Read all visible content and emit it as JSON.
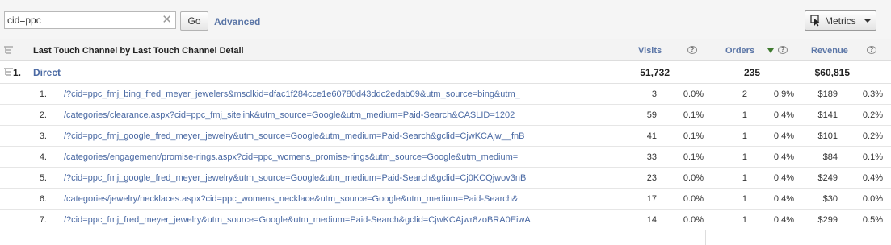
{
  "search": {
    "value": "cid=ppc",
    "clear_label": "✕"
  },
  "toolbar": {
    "go_label": "Go",
    "advanced_label": "Advanced",
    "metrics_label": "Metrics"
  },
  "table": {
    "dimension_header": "Last Touch Channel by Last Touch Channel Detail",
    "metrics": [
      {
        "label": "Visits",
        "help": "?"
      },
      {
        "label": "Orders",
        "help": "?",
        "sorted": "descending"
      },
      {
        "label": "Revenue",
        "help": "?"
      }
    ],
    "group": {
      "index": "1.",
      "label": "Direct",
      "visits": "51,732",
      "orders": "235",
      "revenue": "$60,815"
    },
    "rows": [
      {
        "idx": "1.",
        "label": "/?cid=ppc_fmj_bing_fred_meyer_jewelers&msclkid=dfac1f284cce1e60780d43ddc2edab09&utm_source=bing&utm_",
        "visits": "3",
        "visits_pct": "0.0%",
        "orders": "2",
        "orders_pct": "0.9%",
        "revenue": "$189",
        "revenue_pct": "0.3%"
      },
      {
        "idx": "2.",
        "label": "/categories/clearance.aspx?cid=ppc_fmj_sitelink&utm_source=Google&utm_medium=Paid-Search&CASLID=1202",
        "visits": "59",
        "visits_pct": "0.1%",
        "orders": "1",
        "orders_pct": "0.4%",
        "revenue": "$141",
        "revenue_pct": "0.2%"
      },
      {
        "idx": "3.",
        "label": "/?cid=ppc_fmj_google_fred_meyer_jewelry&utm_source=Google&utm_medium=Paid-Search&gclid=CjwKCAjw__fnB",
        "visits": "41",
        "visits_pct": "0.1%",
        "orders": "1",
        "orders_pct": "0.4%",
        "revenue": "$101",
        "revenue_pct": "0.2%"
      },
      {
        "idx": "4.",
        "label": "/categories/engagement/promise-rings.aspx?cid=ppc_womens_promise-rings&utm_source=Google&utm_medium=",
        "visits": "33",
        "visits_pct": "0.1%",
        "orders": "1",
        "orders_pct": "0.4%",
        "revenue": "$84",
        "revenue_pct": "0.1%"
      },
      {
        "idx": "5.",
        "label": "/?cid=ppc_fmj_google_fred_meyer_jewelry&utm_source=Google&utm_medium=Paid-Search&gclid=Cj0KCQjwov3nB",
        "visits": "23",
        "visits_pct": "0.0%",
        "orders": "1",
        "orders_pct": "0.4%",
        "revenue": "$249",
        "revenue_pct": "0.4%"
      },
      {
        "idx": "6.",
        "label": "/categories/jewelry/necklaces.aspx?cid=ppc_womens_necklace&utm_source=Google&utm_medium=Paid-Search&",
        "visits": "17",
        "visits_pct": "0.0%",
        "orders": "1",
        "orders_pct": "0.4%",
        "revenue": "$30",
        "revenue_pct": "0.0%"
      },
      {
        "idx": "7.",
        "label": "/?cid=ppc_fmj_fred_meyer_jewelry&utm_source=Google&utm_medium=Paid-Search&gclid=CjwKCAjwr8zoBRA0EiwA",
        "visits": "14",
        "visits_pct": "0.0%",
        "orders": "1",
        "orders_pct": "0.4%",
        "revenue": "$299",
        "revenue_pct": "0.5%"
      }
    ]
  },
  "colors": {
    "link": "#4a69a3",
    "header_bg": "#f3f3f3",
    "toolbar_bg": "#f5f5f5",
    "sort_arrow": "#3e7a2e"
  }
}
